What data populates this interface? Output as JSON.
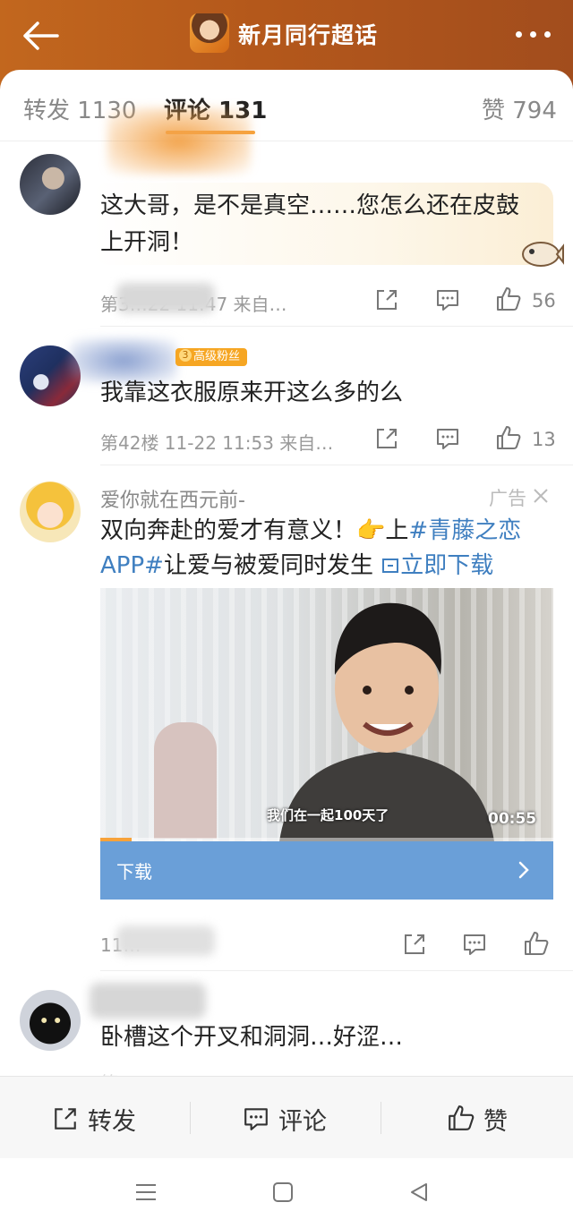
{
  "header": {
    "title": "新月同行超话",
    "back_icon": "arrow-left-icon",
    "more_icon": "more-dots-icon",
    "gradient": [
      "#c2671e",
      "#a24d1d"
    ]
  },
  "tabs": {
    "repost": "转发 1130",
    "comment": "评论 131",
    "like": "赞 794"
  },
  "comments": [
    {
      "text_lines": [
        "这大哥，是不是真空……您怎么还在皮鼓",
        "上开洞！"
      ],
      "meta": "第3…22 11:47 来自…",
      "like_count": "56"
    },
    {
      "badge": "高级粉丝",
      "text": "我靠这衣服原来开这么多的么",
      "meta": "第42楼 11-22 11:53 来自…",
      "like_count": "13"
    },
    {
      "text": "卧槽这个开叉和洞洞…好涩…",
      "meta": "第…"
    }
  ],
  "ad": {
    "username": "爱你就在西元前-",
    "tag": "广告",
    "line1_text": "双向奔赴的爱才有意义！",
    "emoji": "👉",
    "line1_up": "上",
    "hashtag_part1": "#青藤之恋",
    "hashtag_part2": "APP#",
    "line2_text": "让爱与被爱同时发生",
    "link_text": "立即下载",
    "video_caption": "我们在一起100天了",
    "video_duration": "00:55",
    "video_progress": 0.07,
    "download_label": "下载",
    "meta": "11…"
  },
  "bottom_bar": {
    "repost": "转发",
    "comment": "评论",
    "like": "赞"
  },
  "colors": {
    "accent": "#f7a23a",
    "link": "#3f7fc0",
    "download_bar": "#6a9fd8"
  }
}
